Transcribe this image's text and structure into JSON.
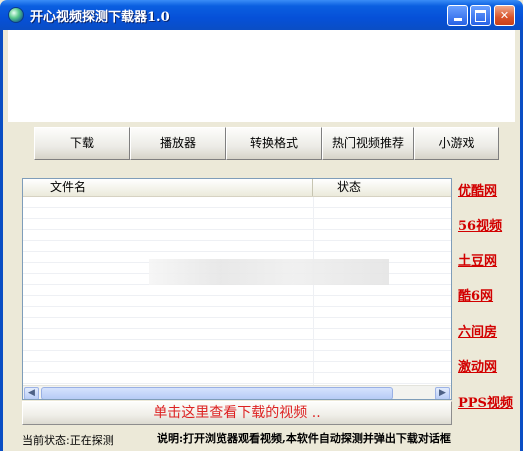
{
  "window": {
    "title": "开心视频探测下载器1.0"
  },
  "toolbar": {
    "buttons": [
      {
        "label": "下载"
      },
      {
        "label": "播放器"
      },
      {
        "label": "转换格式"
      },
      {
        "label": "热门视频推荐"
      },
      {
        "label": "小游戏"
      }
    ]
  },
  "list": {
    "columns": {
      "name": "文件名",
      "status": "状态"
    }
  },
  "view_button": {
    "label": "单击这里查看下载的视频 .."
  },
  "side_links": [
    {
      "label": "优酷网"
    },
    {
      "label": "56视频"
    },
    {
      "label": "土豆网"
    },
    {
      "label": "酷6网"
    },
    {
      "label": "六间房"
    },
    {
      "label": "激动网"
    },
    {
      "label": "PPS视频"
    }
  ],
  "status": {
    "current": "当前状态:正在探测",
    "note": "说明:打开浏览器观看视频,本软件自动探测并弹出下载对话框"
  },
  "colors": {
    "link": "#d20000",
    "titlebar": "#0a5fe0"
  }
}
